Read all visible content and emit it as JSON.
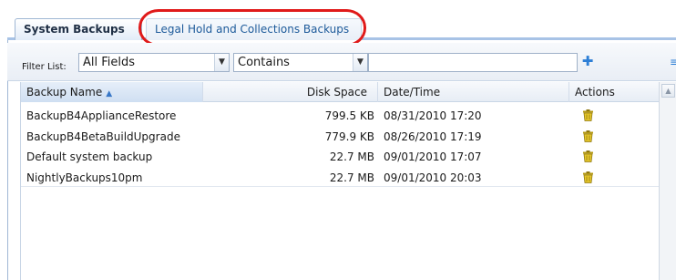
{
  "tabs": [
    {
      "label": "System Backups",
      "active": true
    },
    {
      "label": "Legal Hold and Collections Backups",
      "active": false
    }
  ],
  "highlight_color": "#e01a1a",
  "filter": {
    "label": "Filter List:",
    "field_value": "All Fields",
    "operator_value": "Contains",
    "text_value": "",
    "add_icon": "plus-icon"
  },
  "table": {
    "columns": [
      "Backup Name",
      "Disk Space",
      "Date/Time",
      "Actions"
    ],
    "sort_column": "Backup Name",
    "sort_direction": "ascending",
    "rows": [
      {
        "name": "BackupB4ApplianceRestore",
        "size": "799.5 KB",
        "date": "08/31/2010 17:20",
        "action_icon": "trash-icon"
      },
      {
        "name": "BackupB4BetaBuildUpgrade",
        "size": "779.9 KB",
        "date": "08/26/2010 17:19",
        "action_icon": "trash-icon"
      },
      {
        "name": "Default system backup",
        "size": "22.7 MB",
        "date": "09/01/2010 17:07",
        "action_icon": "trash-icon"
      },
      {
        "name": "NightlyBackups10pm",
        "size": "22.7 MB",
        "date": "09/01/2010 20:03",
        "action_icon": "trash-icon"
      }
    ]
  }
}
